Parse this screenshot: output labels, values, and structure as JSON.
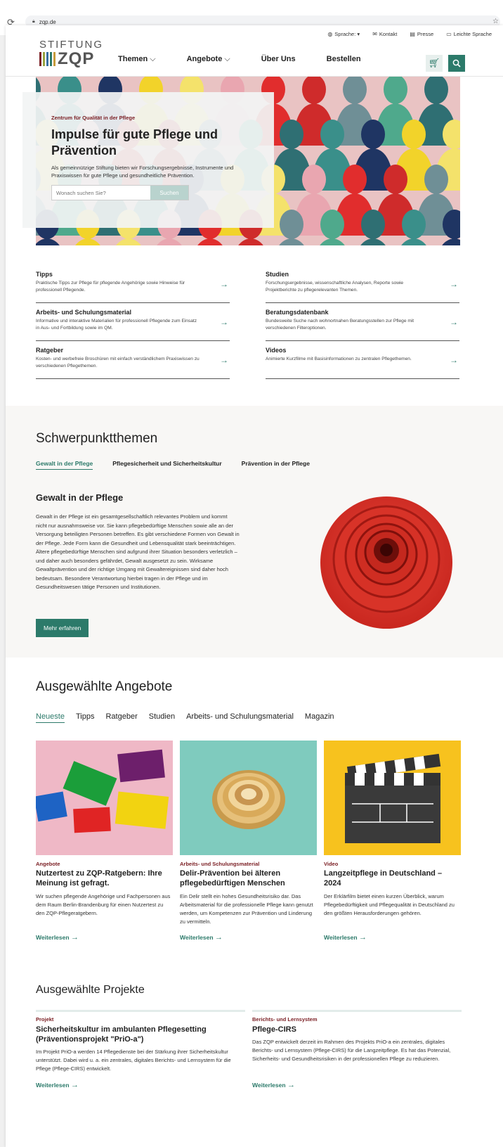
{
  "browser": {
    "url": "zqp.de"
  },
  "topnav": {
    "language": "Sprache:",
    "contact": "Kontakt",
    "press": "Presse",
    "easy": "Leichte Sprache"
  },
  "logo": {
    "line1": "STIFTUNG",
    "line2": "ZQP"
  },
  "mainnav": {
    "items": [
      "Themen",
      "Angebote",
      "Über Uns",
      "Bestellen"
    ]
  },
  "hero": {
    "kicker": "Zentrum für Qualität in der Pflege",
    "title": "Impulse für gute Pflege und Prävention",
    "text": "Als gemeinnützige Stiftung bieten wir Forschungsergebnisse, Instrumente und Praxiswissen für gute Pflege und gesundheitliche Prävention.",
    "search_placeholder": "Wonach suchen Sie?",
    "search_button": "Suchen"
  },
  "links": {
    "left": [
      {
        "title": "Tipps",
        "desc": "Praktische Tipps zur Pflege für pflegende Angehörige sowie Hinweise für professionell Pflegende."
      },
      {
        "title": "Arbeits- und Schulungsmaterial",
        "desc": "Informative und interaktive Materialien für professionell Pflegende zum Einsatz in Aus- und Fortbildung sowie im QM."
      },
      {
        "title": "Ratgeber",
        "desc": "Kosten- und werbefreie Broschüren mit einfach verständlichem Praxiswissen zu verschiedenen Pflegethemen."
      }
    ],
    "right": [
      {
        "title": "Studien",
        "desc": "Forschungsergebnisse, wissenschaftliche Analysen, Reporte sowie Projektberichte zu pflegerelevanten Themen."
      },
      {
        "title": "Beratungsdatenbank",
        "desc": "Bundesweite Suche nach wohnortnahen Beratungsstellen zur Pflege mit verschiedenen Filteroptionen."
      },
      {
        "title": "Videos",
        "desc": "Animierte Kurzfilme mit Basisinformationen zu zentralen Pflegethemen."
      }
    ]
  },
  "schwerpunkt": {
    "heading": "Schwerpunktthemen",
    "tabs": [
      "Gewalt in der Pflege",
      "Pflegesicherheit und Sicherheitskultur",
      "Prävention in der Pflege"
    ],
    "title": "Gewalt in der Pflege",
    "text": "Gewalt in der Pflege ist ein gesamtgesellschaftlich relevantes Problem und kommt nicht nur ausnahmsweise vor. Sie kann pflegebedürftige Menschen sowie alle an der Versorgung beteiligten Personen betreffen. Es gibt verschiedene Formen von Gewalt in der Pflege. Jede Form kann die Gesundheit und Lebensqualität stark beeinträchtigen. Ältere pflegebedürftige Menschen sind aufgrund ihrer Situation besonders verletzlich – und daher auch besonders gefährdet, Gewalt ausgesetzt zu sein. Wirksame Gewaltprävention und der richtige Umgang mit Gewaltereignissen sind daher hoch bedeutsam. Besondere Verantwortung hierbei tragen in der Pflege und im Gesundheitswesen tätige Personen und Institutionen.",
    "button": "Mehr erfahren"
  },
  "angebote": {
    "heading": "Ausgewählte Angebote",
    "tabs": [
      "Neueste",
      "Tipps",
      "Ratgeber",
      "Studien",
      "Arbeits- und Schulungsmaterial",
      "Magazin"
    ],
    "cards": [
      {
        "category": "Angebote",
        "title": "Nutzertest zu ZQP-Ratgebern: Ihre Meinung ist gefragt.",
        "desc": "Wir suchen pflegende Angehörige und Fachpersonen aus dem Raum Berlin-Brandenburg für einen Nutzertest zu den ZQP-Pflegeratgebern.",
        "link": "Weiterlesen"
      },
      {
        "category": "Arbeits- und Schulungsmaterial",
        "title": "Delir-Prävention bei älteren pflegebedürftigen Menschen",
        "desc": "Ein Delir stellt ein hohes Gesundheitsrisiko dar. Das Arbeitsmaterial für die professionelle Pflege kann genutzt werden, um Kompetenzen zur Prävention und Linderung zu vermitteln.",
        "link": "Weiterlesen"
      },
      {
        "category": "Video",
        "title": "Langzeitpflege in Deutschland – 2024",
        "desc": "Der Erklärfilm bietet einen kurzen Überblick, warum Pflegebedürftigkeit und Pflegequalität in Deutschland zu den größten Herausforderungen gehören.",
        "link": "Weiterlesen"
      }
    ]
  },
  "projekte": {
    "heading": "Ausgewählte Projekte",
    "items": [
      {
        "category": "Projekt",
        "title": "Sicherheitskultur im ambulanten Pflegesetting (Präventionsprojekt \"PriO-a\")",
        "desc": "Im Projekt PriO-a werden 14 Pflegedienste bei der Stärkung ihrer Sicherheitskultur unterstützt. Dabei wird u. a. ein zentrales, digitales Berichts- und Lernsystem für die Pflege (Pflege-CIRS) entwickelt.",
        "link": "Weiterlesen"
      },
      {
        "category": "Berichts- und Lernsystem",
        "title": "Pflege-CIRS",
        "desc": "Das ZQP entwickelt derzeit im Rahmen des Projekts PriO-a ein zentrales, digitales Berichts- und Lernsystem (Pflege-CIRS) für die Langzeitpflege. Es hat das Potenzial, Sicherheits- und Gesundheitsrisiken in der professionellen Pflege zu reduzieren.",
        "link": "Weiterlesen"
      }
    ]
  },
  "colors": {
    "accent": "#2c7a6a",
    "kicker": "#7a1d22"
  }
}
